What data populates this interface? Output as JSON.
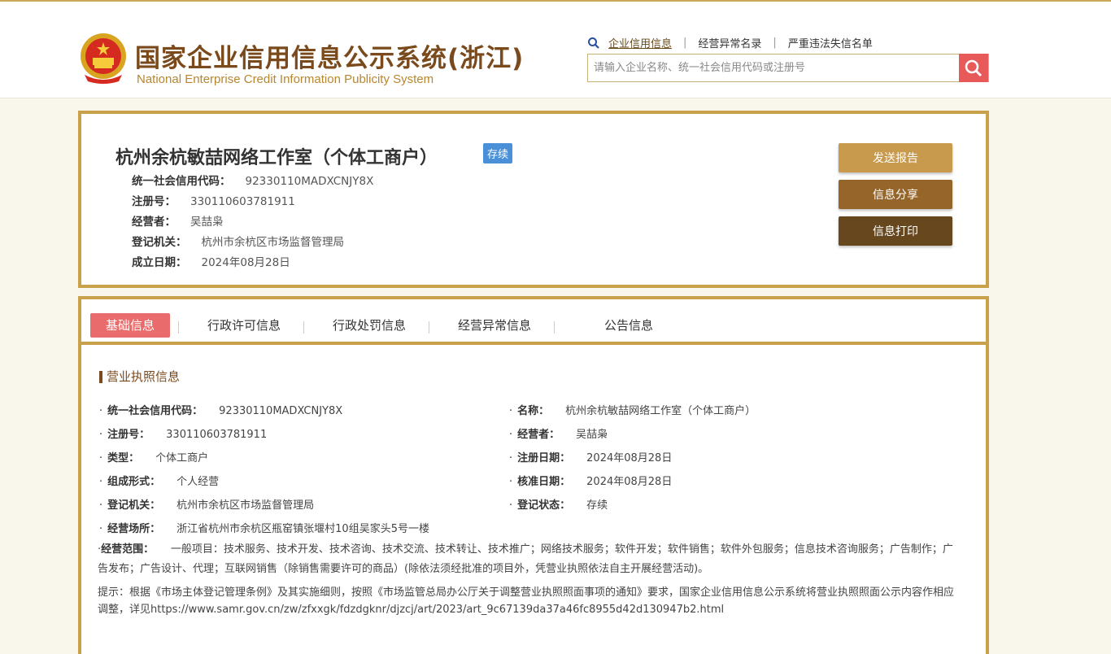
{
  "header": {
    "logo_cn": "国家企业信用信息公示系统(浙江)",
    "logo_en": "National Enterprise Credit Information Publicity System",
    "links": [
      "企业信用信息",
      "经营异常名录",
      "严重违法失信名单"
    ],
    "search_placeholder": "请输入企业名称、统一社会信用代码或注册号"
  },
  "company": {
    "name": "杭州余杭敏喆网络工作室（个体工商户）",
    "status_badge": "存续",
    "credit_code_label": "统一社会信用代码：",
    "credit_code": "92330110MADXCNJY8X",
    "reg_no_label": "注册号：",
    "reg_no": "330110603781911",
    "operator_label": "经营者：",
    "operator": "吴喆枭",
    "authority_label": "登记机关：",
    "authority": "杭州市余杭区市场监督管理局",
    "est_date_label": "成立日期：",
    "est_date": "2024年08月28日"
  },
  "actions": {
    "send_report": "发送报告",
    "share": "信息分享",
    "print": "信息打印"
  },
  "colors": {
    "send_report": "#c89a4e",
    "share": "#96652a",
    "print": "#66471e"
  },
  "tabs": [
    "基础信息",
    "行政许可信息",
    "行政处罚信息",
    "经营异常信息",
    "公告信息"
  ],
  "license": {
    "title": "营业执照信息",
    "credit_code_label": "统一社会信用代码：",
    "credit_code": "92330110MADXCNJY8X",
    "name_label": "名称：",
    "name": "杭州余杭敏喆网络工作室（个体工商户）",
    "reg_no_label": "注册号：",
    "reg_no": "330110603781911",
    "operator_label": "经营者：",
    "operator": "吴喆枭",
    "type_label": "类型：",
    "type": "个体工商户",
    "reg_date_label": "注册日期：",
    "reg_date": "2024年08月28日",
    "form_label": "组成形式：",
    "form": "个人经营",
    "approve_date_label": "核准日期：",
    "approve_date": "2024年08月28日",
    "authority_label": "登记机关：",
    "authority": "杭州市余杭区市场监督管理局",
    "status_label": "登记状态：",
    "status": "存续",
    "address_label": "经营场所：",
    "address": "浙江省杭州市余杭区瓶窑镇张堰村10组吴家头5号一楼",
    "scope_label": "经营范围：",
    "scope": "一般项目：技术服务、技术开发、技术咨询、技术交流、技术转让、技术推广；网络技术服务；软件开发；软件销售；软件外包服务；信息技术咨询服务；广告制作；广告发布；广告设计、代理；互联网销售（除销售需要许可的商品）(除依法须经批准的项目外，凭营业执照依法自主开展经营活动)。",
    "note": "提示：根据《市场主体登记管理条例》及其实施细则，按照《市场监管总局办公厅关于调整营业执照照面事项的通知》要求，国家企业信用信息公示系统将营业执照照面公示内容作相应调整，详见https://www.samr.gov.cn/zw/zfxxgk/fdzdgknr/djzcj/art/2023/art_9c67139da37a46fc8955d42d130947b2.html"
  }
}
